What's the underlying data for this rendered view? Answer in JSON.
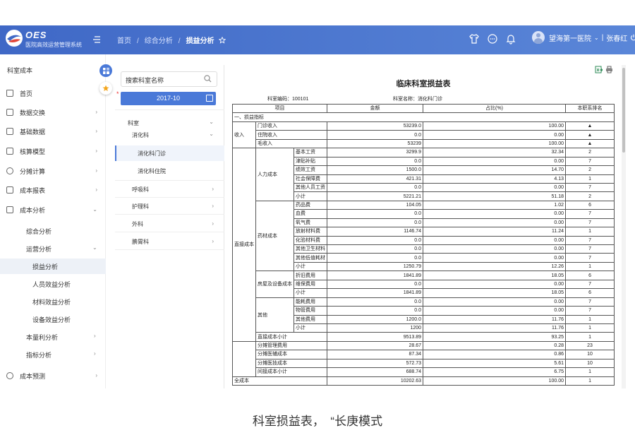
{
  "app": {
    "logo_text": "OES",
    "subtitle": "医院高效运营管理系统"
  },
  "breadcrumb": [
    "首页",
    "综合分析",
    "损益分析"
  ],
  "user": {
    "hospital": "望海第一医院",
    "name": "张春红"
  },
  "sidebar": {
    "title": "科室成本",
    "items": [
      {
        "label": "首页",
        "icon": "home-icon"
      },
      {
        "label": "数据交换",
        "icon": "clipboard-icon"
      },
      {
        "label": "基础数据",
        "icon": "database-icon"
      },
      {
        "label": "核算模型",
        "icon": "model-icon"
      },
      {
        "label": "分摊计算",
        "icon": "calculator-icon"
      },
      {
        "label": "成本报表",
        "icon": "report-icon"
      },
      {
        "label": "成本分析",
        "icon": "analysis-icon"
      }
    ],
    "sub": [
      "综合分析",
      "运营分析",
      "损益分析",
      "人员效益分析",
      "材料效益分析",
      "设备效益分析",
      "本量利分析",
      "指标分析"
    ],
    "last": {
      "label": "成本预测",
      "icon": "forecast-icon"
    }
  },
  "tree": {
    "search_placeholder": "搜索科室名称",
    "period": "2017-10",
    "nodes": [
      "科室",
      "消化科",
      "消化科门诊",
      "消化科住院",
      "呼吸科",
      "护理科",
      "外科",
      "腆胃科"
    ]
  },
  "report": {
    "title": "临床科室损益表",
    "dept_code_label": "科室编码：",
    "dept_code": "100101",
    "dept_name_label": "科室名称：",
    "dept_name": "消化科门诊",
    "headers": [
      "项目",
      "金额",
      "占比(%)",
      "本职系排名"
    ],
    "section": "一、损益指标",
    "income_group": "收入",
    "income": [
      {
        "item": "门诊收入",
        "amount": "53239.0",
        "pct": "100.00",
        "rank": "▲"
      },
      {
        "item": "住院收入",
        "amount": "0.0",
        "pct": "0.00",
        "rank": "▲"
      },
      {
        "item": "毛收入",
        "amount": "53239",
        "pct": "100.00",
        "rank": "▲"
      }
    ],
    "direct_group": "直接成本",
    "groups": [
      {
        "name": "人力成本",
        "rows": [
          {
            "item": "基本工资",
            "amount": "3299.9",
            "pct": "32.34",
            "rank": "2"
          },
          {
            "item": "津贴补贴",
            "amount": "0.0",
            "pct": "0.00",
            "rank": "7"
          },
          {
            "item": "绩效工资",
            "amount": "1500.0",
            "pct": "14.70",
            "rank": "2"
          },
          {
            "item": "社会保障费",
            "amount": "421.31",
            "pct": "4.13",
            "rank": "1"
          },
          {
            "item": "其他人员工资",
            "amount": "0.0",
            "pct": "0.00",
            "rank": "7"
          },
          {
            "item": "小计",
            "amount": "5221.21",
            "pct": "51.18",
            "rank": "2"
          }
        ]
      },
      {
        "name": "药材成本",
        "rows": [
          {
            "item": "药品费",
            "amount": "104.05",
            "pct": "1.02",
            "rank": "6"
          },
          {
            "item": "血费",
            "amount": "0.0",
            "pct": "0.00",
            "rank": "7"
          },
          {
            "item": "氧气费",
            "amount": "0.0",
            "pct": "0.00",
            "rank": "7"
          },
          {
            "item": "放射材料费",
            "amount": "1146.74",
            "pct": "11.24",
            "rank": "1"
          },
          {
            "item": "化验材料费",
            "amount": "0.0",
            "pct": "0.00",
            "rank": "7"
          },
          {
            "item": "其他卫生材料",
            "amount": "0.0",
            "pct": "0.00",
            "rank": "7"
          },
          {
            "item": "其他低值耗材",
            "amount": "0.0",
            "pct": "0.00",
            "rank": "7"
          },
          {
            "item": "小计",
            "amount": "1250.79",
            "pct": "12.26",
            "rank": "1"
          }
        ]
      },
      {
        "name": "房屋及设备成本",
        "rows": [
          {
            "item": "折旧费用",
            "amount": "1841.89",
            "pct": "18.05",
            "rank": "6"
          },
          {
            "item": "维保费用",
            "amount": "0.0",
            "pct": "0.00",
            "rank": "7"
          },
          {
            "item": "小计",
            "amount": "1841.89",
            "pct": "18.05",
            "rank": "6"
          }
        ]
      },
      {
        "name": "其他",
        "rows": [
          {
            "item": "能耗费用",
            "amount": "0.0",
            "pct": "0.00",
            "rank": "7"
          },
          {
            "item": "物管费用",
            "amount": "0.0",
            "pct": "0.00",
            "rank": "7"
          },
          {
            "item": "其他费用",
            "amount": "1200.0",
            "pct": "11.76",
            "rank": "1"
          },
          {
            "item": "小计",
            "amount": "1200",
            "pct": "11.76",
            "rank": "1"
          }
        ]
      }
    ],
    "direct_total": {
      "item": "直接成本小计",
      "amount": "9513.89",
      "pct": "93.25",
      "rank": "1"
    },
    "indirect": [
      {
        "item": "分摊管理费用",
        "amount": "28.67",
        "pct": "0.28",
        "rank": "23"
      },
      {
        "item": "分摊医辅成本",
        "amount": "87.34",
        "pct": "0.86",
        "rank": "10"
      },
      {
        "item": "分摊医技成本",
        "amount": "572.73",
        "pct": "5.61",
        "rank": "10"
      },
      {
        "item": "间接成本小计",
        "amount": "688.74",
        "pct": "6.75",
        "rank": "1"
      }
    ],
    "full_cost": {
      "item": "全成本",
      "amount": "10202.63",
      "pct": "100.00",
      "rank": "1"
    }
  },
  "caption": "科室损益表，　“长庚模式"
}
